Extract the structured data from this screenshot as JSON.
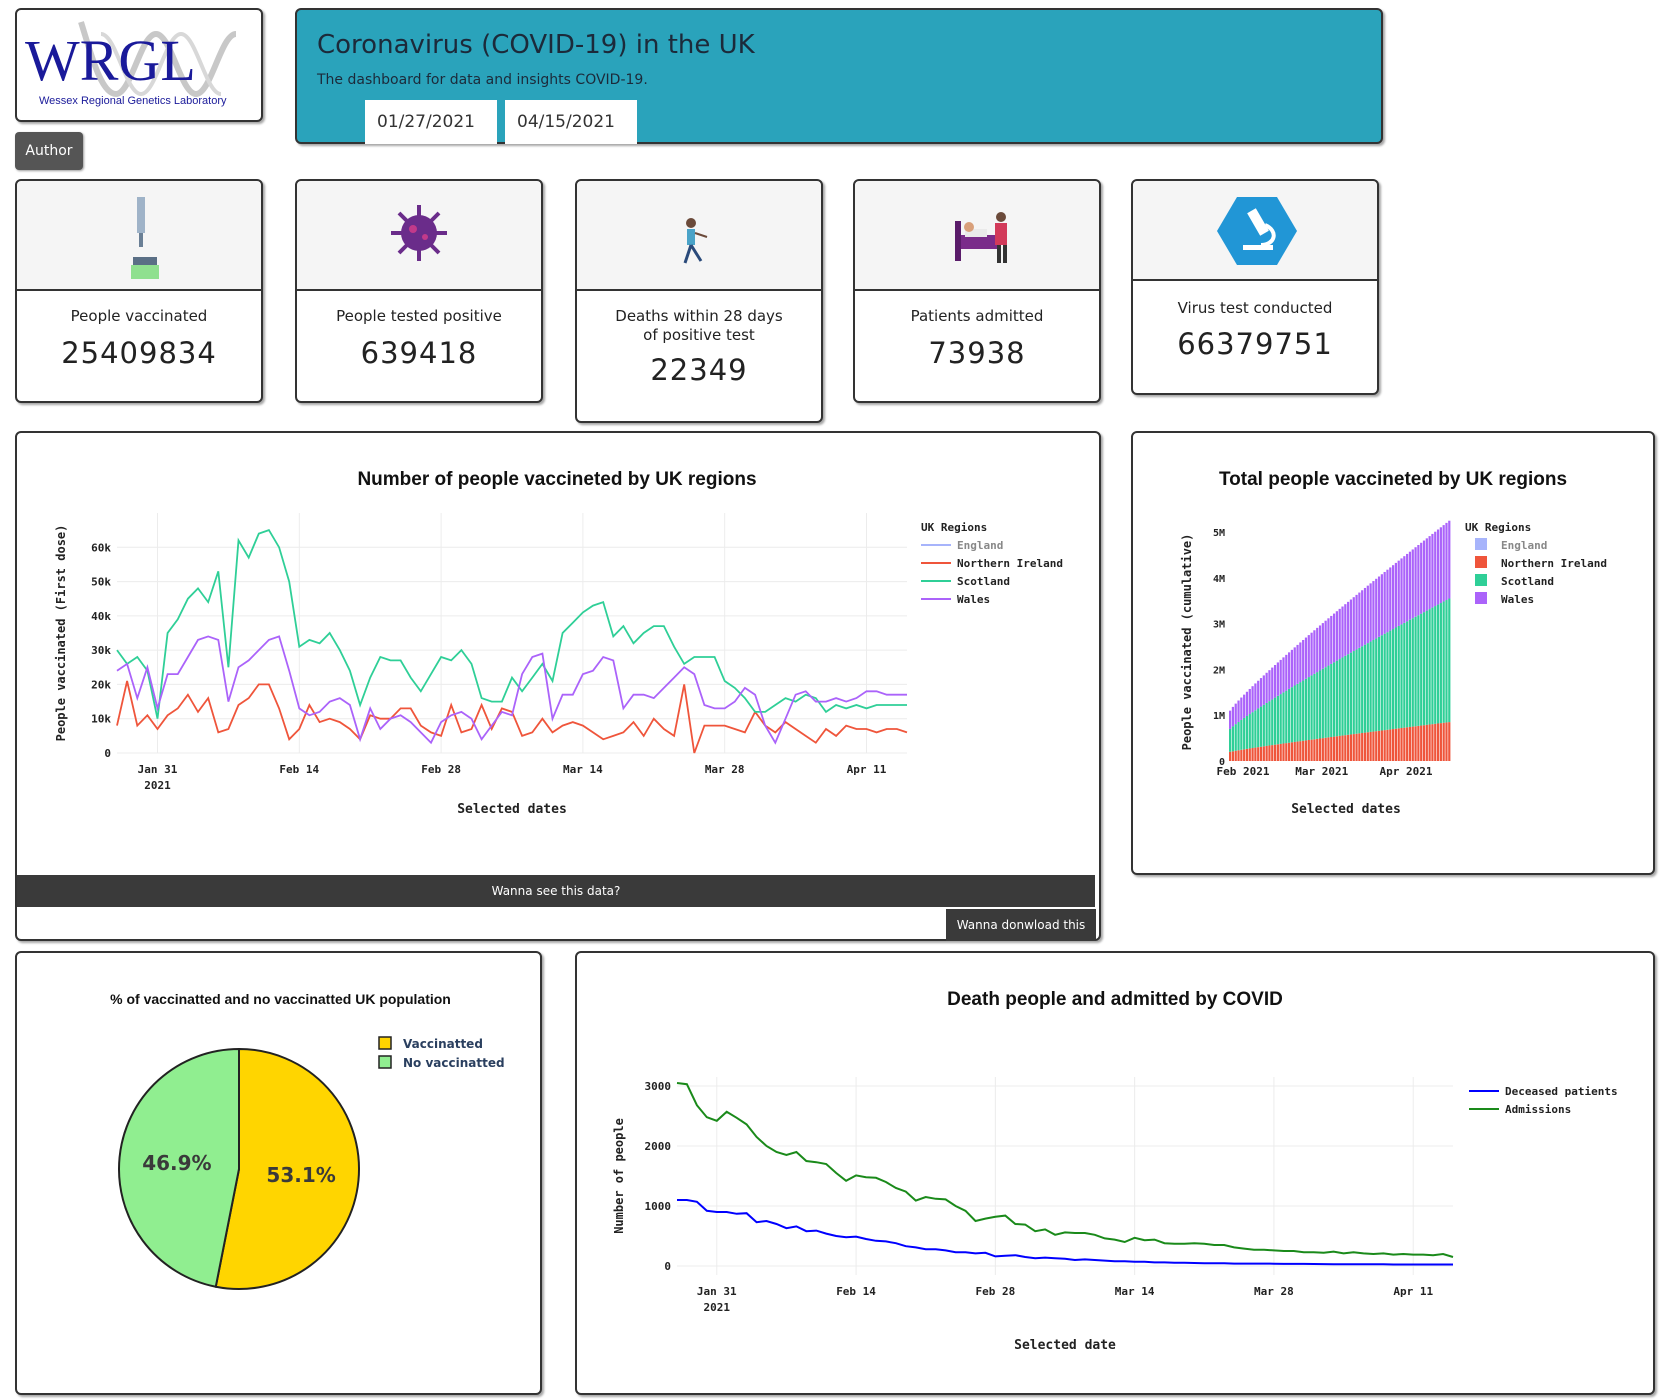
{
  "logo": {
    "text": "WRGL",
    "subtext": "Wessex Regional Genetics Laboratory"
  },
  "header": {
    "title": "Coronavirus (COVID-19) in the UK",
    "subtitle": "The dashboard for data and insights COVID-19.",
    "start_date": "01/27/2021",
    "end_date": "04/15/2021"
  },
  "author_button": "Author",
  "cards": [
    {
      "label": "People vaccinated",
      "value": "25409834",
      "icon": "vaccine-icon"
    },
    {
      "label": "People tested positive",
      "value": "639418",
      "icon": "virus-icon"
    },
    {
      "label": "Deaths within 28 days of positive test",
      "value": "22349",
      "icon": "person-icon"
    },
    {
      "label": "Patients admitted",
      "value": "73938",
      "icon": "hospital-bed-icon"
    },
    {
      "label": "Virus test conducted",
      "value": "66379751",
      "icon": "microscope-icon"
    }
  ],
  "buttons": {
    "see_data": "Wanna see this data?",
    "download_data": "Wanna donwload this data"
  },
  "colors": {
    "england": "#a7b4fb",
    "northern_ireland": "#ef553b",
    "scotland": "#2fcf97",
    "wales": "#ab63fa",
    "deceased": "#0000ff",
    "admissions": "#1a8a1a",
    "vaccinated": "#ffd500",
    "no_vaccinated": "#90ee90",
    "header_bg": "#2aa3bb"
  },
  "chart_data": [
    {
      "id": "daily",
      "type": "line",
      "title": "Number of people vaccineted by UK regions",
      "xlabel": "Selected dates",
      "ylabel": "People vaccinated (First dose)",
      "legend_title": "UK Regions",
      "legend_placement": "top-right",
      "xticks": [
        "Jan 31",
        "Feb 14",
        "Feb 28",
        "Mar 14",
        "Mar 28",
        "Apr 11"
      ],
      "xtick_sub": "2021",
      "yticks": [
        "0",
        "10k",
        "20k",
        "30k",
        "40k",
        "50k",
        "60k"
      ],
      "ylim": [
        0,
        70000
      ],
      "grid": true,
      "series": [
        {
          "name": "England",
          "values": []
        },
        {
          "name": "Northern Ireland",
          "values": [
            8000,
            21000,
            8000,
            11000,
            7000,
            11000,
            13000,
            17000,
            12000,
            16000,
            6000,
            7000,
            14000,
            16000,
            20000,
            20000,
            13000,
            4000,
            7000,
            14000,
            9000,
            10000,
            9000,
            7000,
            4000,
            11000,
            10000,
            10000,
            13000,
            13000,
            8000,
            6000,
            5000,
            14000,
            6000,
            7000,
            14000,
            7000,
            13000,
            12000,
            5000,
            6000,
            10000,
            6000,
            8000,
            9000,
            8000,
            6000,
            4000,
            5000,
            6000,
            9000,
            5000,
            10000,
            7000,
            5000,
            20000,
            0,
            8000,
            8000,
            8000,
            7000,
            6000,
            12000,
            8000,
            6000,
            9000,
            7000,
            5000,
            3000,
            7000,
            5000,
            8000,
            7000,
            7000,
            6000,
            7000,
            7000,
            6000
          ]
        },
        {
          "name": "Scotland",
          "values": [
            30000,
            26000,
            28000,
            24000,
            10000,
            35000,
            39000,
            45000,
            48000,
            44000,
            53000,
            25000,
            62000,
            57000,
            64000,
            65000,
            60000,
            50000,
            31000,
            33000,
            32000,
            35000,
            30000,
            24000,
            14000,
            22000,
            28000,
            27000,
            27000,
            22000,
            18000,
            23000,
            28000,
            27000,
            30000,
            26000,
            16000,
            15000,
            15000,
            22000,
            18000,
            22000,
            26000,
            21000,
            35000,
            38000,
            41000,
            43000,
            44000,
            34000,
            37000,
            32000,
            35000,
            37000,
            37000,
            31000,
            26000,
            28000,
            28000,
            28000,
            21000,
            19000,
            16000,
            12000,
            12000,
            14000,
            16000,
            15000,
            17000,
            16000,
            12000,
            14000,
            13000,
            14000,
            13000,
            14000,
            14000,
            14000,
            14000
          ]
        },
        {
          "name": "Wales",
          "values": [
            24000,
            26000,
            16000,
            25000,
            13000,
            23000,
            23000,
            28000,
            33000,
            34000,
            33000,
            15000,
            25000,
            27000,
            30000,
            33000,
            34000,
            24000,
            13000,
            11000,
            12000,
            15000,
            16000,
            14000,
            4000,
            13000,
            7000,
            10000,
            11000,
            9000,
            6000,
            3000,
            9000,
            11000,
            12000,
            10000,
            4000,
            8000,
            12000,
            11000,
            23000,
            28000,
            29000,
            10000,
            17000,
            17000,
            23000,
            24000,
            28000,
            27000,
            13000,
            17000,
            17000,
            16000,
            19000,
            22000,
            25000,
            23000,
            14000,
            13000,
            13000,
            15000,
            19000,
            17000,
            8000,
            3000,
            10000,
            17000,
            18000,
            15000,
            15000,
            16000,
            15000,
            16000,
            18000,
            18000,
            17000,
            17000,
            17000
          ]
        }
      ]
    },
    {
      "id": "cumulative",
      "type": "bar",
      "title": "Total people vaccineted by UK regions",
      "xlabel": "Selected dates",
      "ylabel": "People vaccinated (cumulative)",
      "legend_title": "UK Regions",
      "legend_placement": "top-right",
      "stacked": true,
      "xticks": [
        "Feb 2021",
        "Mar 2021",
        "Apr 2021"
      ],
      "yticks": [
        "0",
        "1M",
        "2M",
        "3M",
        "4M",
        "5M"
      ],
      "ylim": [
        0,
        5200000
      ],
      "series": [
        {
          "name": "England",
          "start": 0,
          "end": 0
        },
        {
          "name": "Northern Ireland",
          "start": 200000,
          "end": 850000
        },
        {
          "name": "Scotland",
          "start": 500000,
          "end": 2700000
        },
        {
          "name": "Wales",
          "start": 400000,
          "end": 1700000
        }
      ]
    },
    {
      "id": "pie",
      "type": "pie",
      "title": "% of vaccinatted and no vaccinatted UK population",
      "legend_placement": "top-right",
      "slices": [
        {
          "name": "Vaccinatted",
          "value": 53.1,
          "label": "53.1%"
        },
        {
          "name": "No vaccinatted",
          "value": 46.9,
          "label": "46.9%"
        }
      ]
    },
    {
      "id": "deaths",
      "type": "line",
      "title": "Death people and admitted by COVID",
      "xlabel": "Selected date",
      "ylabel": "Number of people",
      "legend_placement": "top-right",
      "xticks": [
        "Jan 31",
        "Feb 14",
        "Feb 28",
        "Mar 14",
        "Mar 28",
        "Apr 11"
      ],
      "xtick_sub": "2021",
      "yticks": [
        "0",
        "1000",
        "2000",
        "3000"
      ],
      "ylim": [
        -150,
        3150
      ],
      "grid": true,
      "series": [
        {
          "name": "Deceased patients",
          "values": [
            1100,
            1100,
            1070,
            920,
            900,
            900,
            870,
            880,
            730,
            750,
            700,
            630,
            660,
            580,
            590,
            540,
            500,
            480,
            490,
            450,
            420,
            410,
            380,
            330,
            310,
            280,
            280,
            260,
            230,
            230,
            210,
            220,
            160,
            170,
            180,
            150,
            130,
            140,
            130,
            120,
            100,
            110,
            100,
            90,
            80,
            80,
            70,
            70,
            60,
            60,
            55,
            55,
            50,
            45,
            45,
            45,
            40,
            40,
            40,
            40,
            38,
            35,
            35,
            35,
            33,
            32,
            30,
            30,
            30,
            30,
            28,
            28,
            25,
            25,
            25,
            25,
            25,
            25,
            25
          ]
        },
        {
          "name": "Admissions",
          "values": [
            3050,
            3030,
            2680,
            2480,
            2420,
            2570,
            2470,
            2360,
            2150,
            2000,
            1900,
            1850,
            1900,
            1750,
            1730,
            1700,
            1550,
            1420,
            1510,
            1480,
            1470,
            1400,
            1300,
            1240,
            1090,
            1150,
            1120,
            1110,
            1000,
            920,
            750,
            790,
            820,
            840,
            700,
            690,
            580,
            610,
            520,
            560,
            550,
            550,
            520,
            460,
            440,
            400,
            470,
            430,
            440,
            380,
            370,
            370,
            380,
            370,
            350,
            350,
            310,
            290,
            270,
            270,
            260,
            250,
            250,
            230,
            230,
            220,
            240,
            210,
            230,
            210,
            200,
            210,
            190,
            200,
            190,
            190,
            180,
            200,
            150
          ]
        }
      ]
    }
  ]
}
